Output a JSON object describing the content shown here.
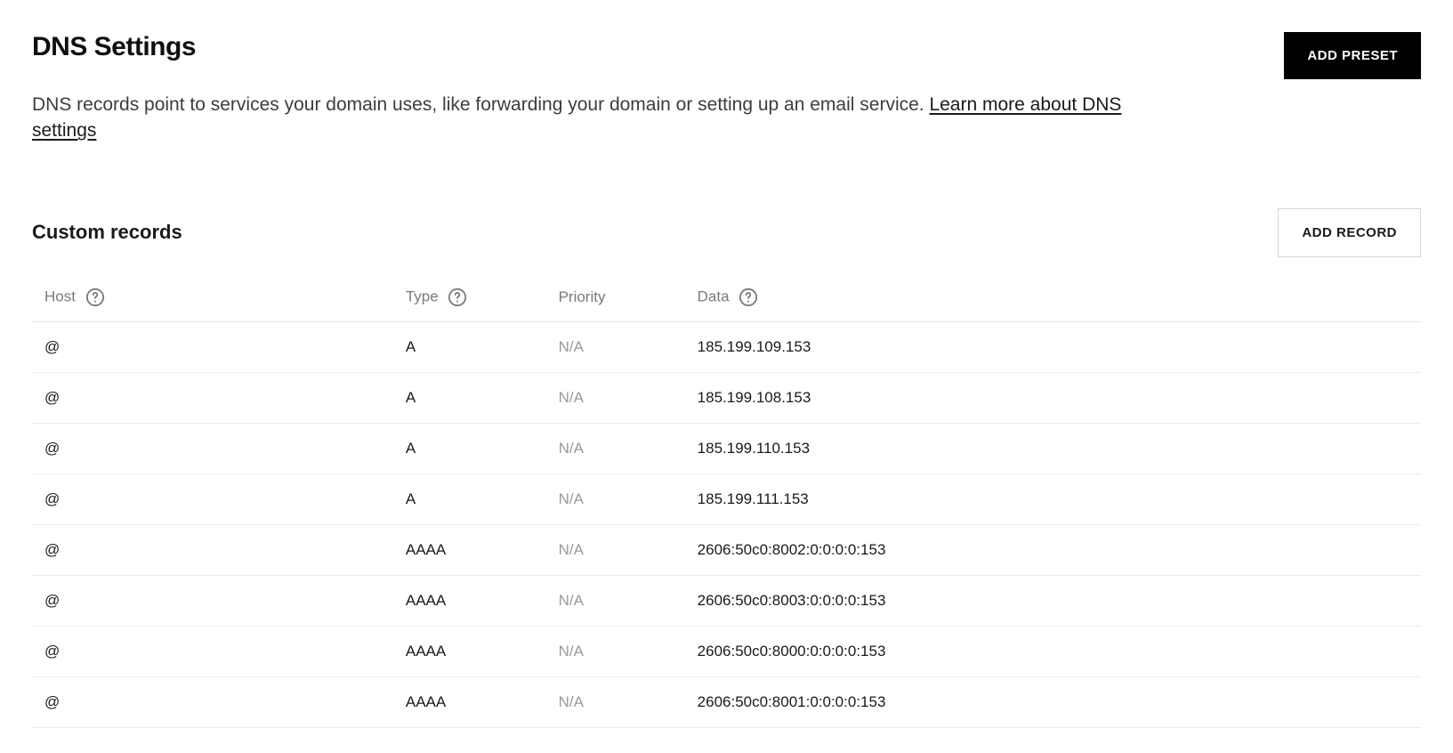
{
  "header": {
    "title": "DNS Settings",
    "add_preset_label": "ADD PRESET",
    "description_text": "DNS records point to services your domain uses, like forwarding your domain or setting up an email service. ",
    "learn_more_text": "Learn more about DNS settings"
  },
  "section": {
    "title": "Custom records",
    "add_record_label": "ADD RECORD"
  },
  "table": {
    "columns": {
      "host": "Host",
      "type": "Type",
      "priority": "Priority",
      "data": "Data"
    },
    "rows": [
      {
        "host": "@",
        "type": "A",
        "priority": "N/A",
        "data": "185.199.109.153"
      },
      {
        "host": "@",
        "type": "A",
        "priority": "N/A",
        "data": "185.199.108.153"
      },
      {
        "host": "@",
        "type": "A",
        "priority": "N/A",
        "data": "185.199.110.153"
      },
      {
        "host": "@",
        "type": "A",
        "priority": "N/A",
        "data": "185.199.111.153"
      },
      {
        "host": "@",
        "type": "AAAA",
        "priority": "N/A",
        "data": "2606:50c0:8002:0:0:0:0:153"
      },
      {
        "host": "@",
        "type": "AAAA",
        "priority": "N/A",
        "data": "2606:50c0:8003:0:0:0:0:153"
      },
      {
        "host": "@",
        "type": "AAAA",
        "priority": "N/A",
        "data": "2606:50c0:8000:0:0:0:0:153"
      },
      {
        "host": "@",
        "type": "AAAA",
        "priority": "N/A",
        "data": "2606:50c0:8001:0:0:0:0:153"
      }
    ]
  }
}
